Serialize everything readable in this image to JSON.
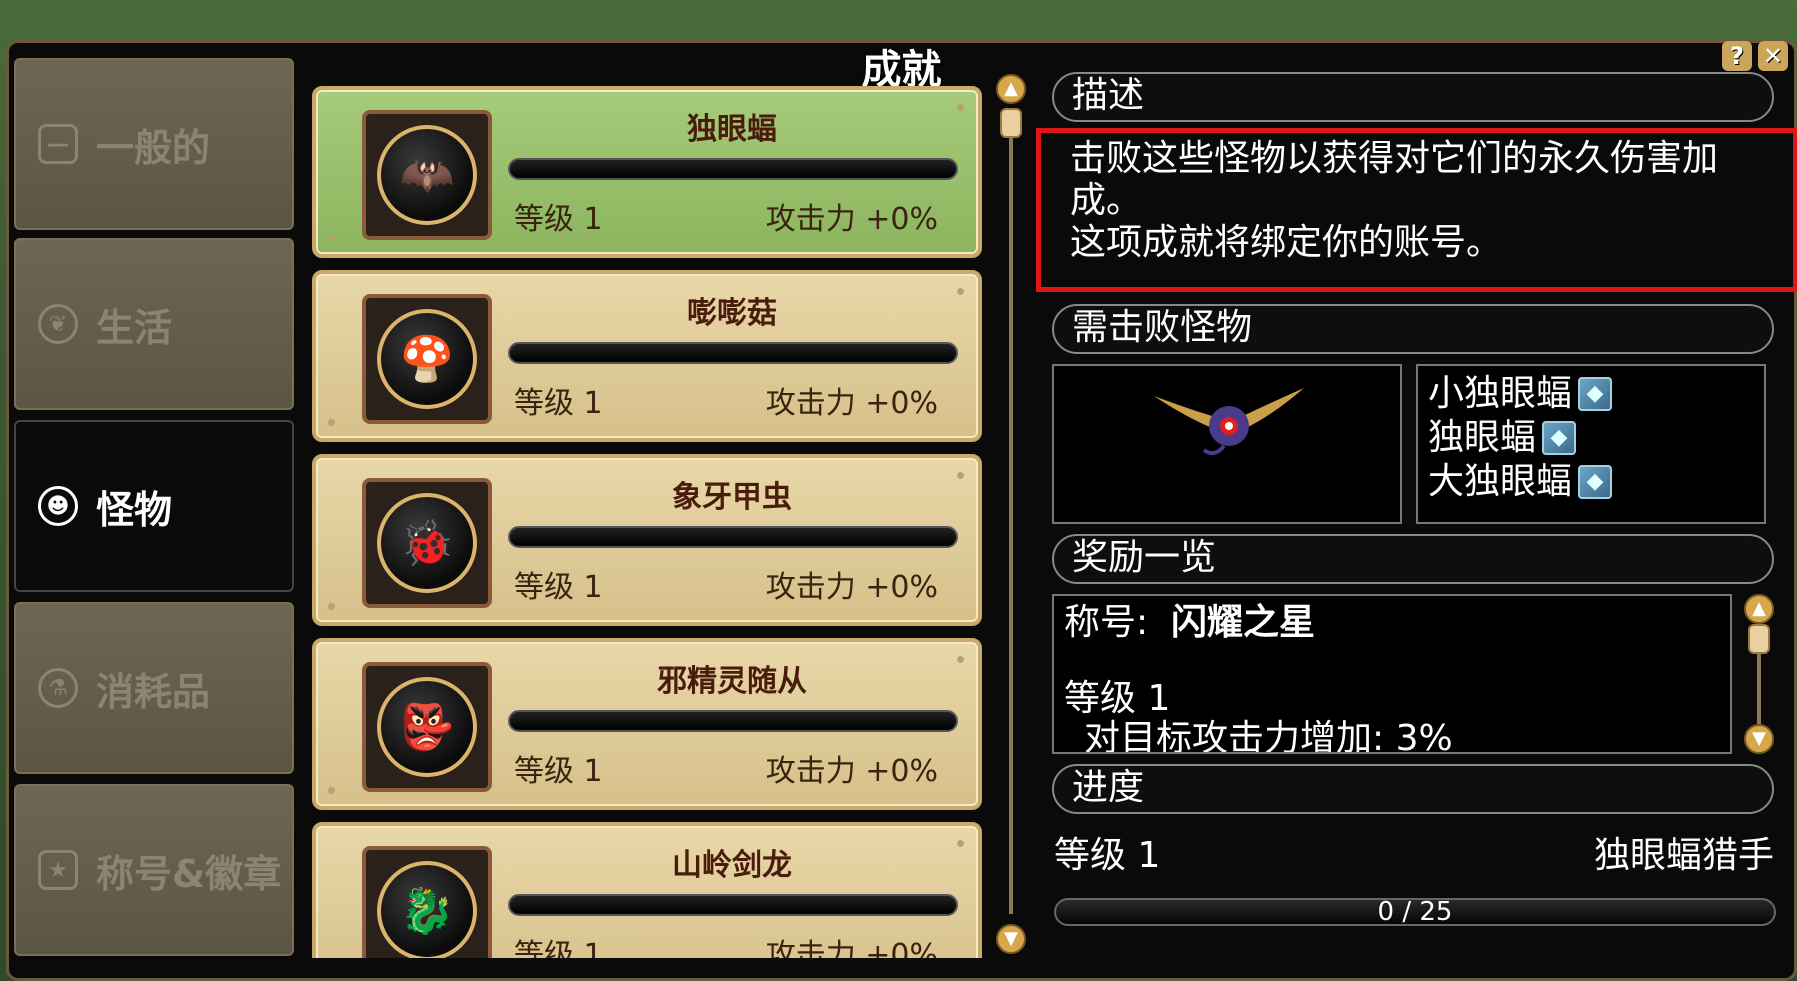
{
  "window": {
    "title": "成就",
    "help_icon": "question-icon",
    "close_icon": "close-icon"
  },
  "sidebar": {
    "items": [
      {
        "label": "一般的",
        "icon": "general-icon",
        "active": false
      },
      {
        "label": "生活",
        "icon": "leaf-icon",
        "active": false
      },
      {
        "label": "怪物",
        "icon": "monster-icon",
        "active": true
      },
      {
        "label": "消耗品",
        "icon": "potion-icon",
        "active": false
      },
      {
        "label": "称号&徽章",
        "icon": "badge-icon",
        "active": false
      }
    ]
  },
  "list": {
    "items": [
      {
        "name": "独眼蝠",
        "level": "等级 1",
        "attack": "攻击力 +0%",
        "selected": true,
        "icon": "bat-icon",
        "progress": 0
      },
      {
        "name": "嘭嘭菇",
        "level": "等级 1",
        "attack": "攻击力 +0%",
        "selected": false,
        "icon": "mushroom-icon",
        "progress": 0
      },
      {
        "name": "象牙甲虫",
        "level": "等级 1",
        "attack": "攻击力 +0%",
        "selected": false,
        "icon": "beetle-icon",
        "progress": 0
      },
      {
        "name": "邪精灵随从",
        "level": "等级 1",
        "attack": "攻击力 +0%",
        "selected": false,
        "icon": "imp-icon",
        "progress": 0
      },
      {
        "name": "山岭剑龙",
        "level": "等级 1",
        "attack": "攻击力 +0%",
        "selected": false,
        "icon": "dragon-icon",
        "progress": 0
      }
    ]
  },
  "detail": {
    "desc_header": "描述",
    "desc_line1": "击败这些怪物以获得对它们的永久伤害加",
    "desc_line2": "成。",
    "desc_line3": "这项成就将绑定你的账号。",
    "monsters_header": "需击败怪物",
    "monsters": [
      "小独眼蝠",
      "独眼蝠",
      "大独眼蝠"
    ],
    "rewards_header": "奖励一览",
    "reward_title_label": "称号:",
    "reward_title_value": "闪耀之星",
    "reward_level": "等级 1",
    "reward_effect": "对目标攻击力增加: 3%",
    "progress_header": "进度",
    "progress_level": "等级 1",
    "progress_title": "独眼蝠猎手",
    "progress_text": "0 / 25",
    "progress_value": 0
  },
  "colors": {
    "highlight": "#e01515",
    "selected_card": "#a6cb7a",
    "card": "#e8d7a8"
  }
}
